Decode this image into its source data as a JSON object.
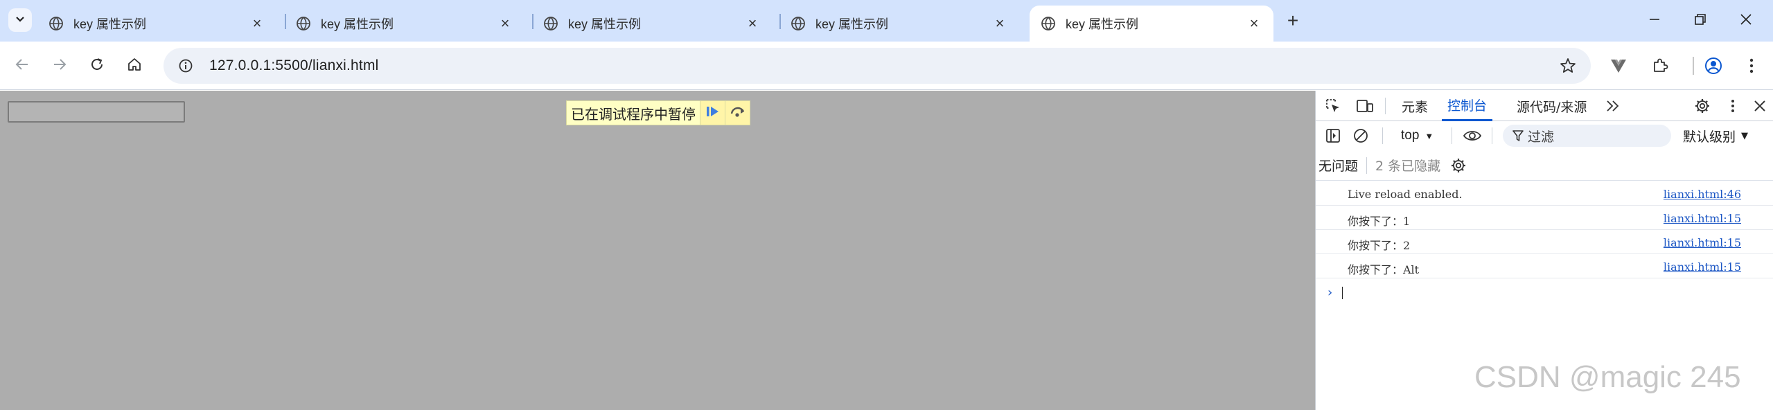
{
  "browser": {
    "tabs": [
      {
        "title": "key 属性示例",
        "active": false
      },
      {
        "title": "key 属性示例",
        "active": false
      },
      {
        "title": "key 属性示例",
        "active": false
      },
      {
        "title": "key 属性示例",
        "active": false
      },
      {
        "title": "key 属性示例",
        "active": true
      }
    ],
    "new_tab_label": "+",
    "address_url": "127.0.0.1:5500/lianxi.html",
    "accent_color": "#d3e3fd"
  },
  "page": {
    "paused_text": "已在调试程序中暂停",
    "background_color": "#adadad"
  },
  "devtools": {
    "tabs": {
      "elements": "元素",
      "console": "控制台",
      "sources": "源代码/来源"
    },
    "context": "top",
    "filter_placeholder": "过滤",
    "levels": "默认级别",
    "no_issues": "无问题",
    "hidden_count": "2 条已隐藏",
    "logs": [
      {
        "message": "Live reload enabled.",
        "source": "lianxi.html:46"
      },
      {
        "message": "你按下了：1",
        "source": "lianxi.html:15"
      },
      {
        "message": "你按下了：2",
        "source": "lianxi.html:15"
      },
      {
        "message": "你按下了：Alt",
        "source": "lianxi.html:15"
      }
    ],
    "prompt_symbol": "›",
    "accent_color": "#0b57d0"
  },
  "watermark": "CSDN @magic 245"
}
